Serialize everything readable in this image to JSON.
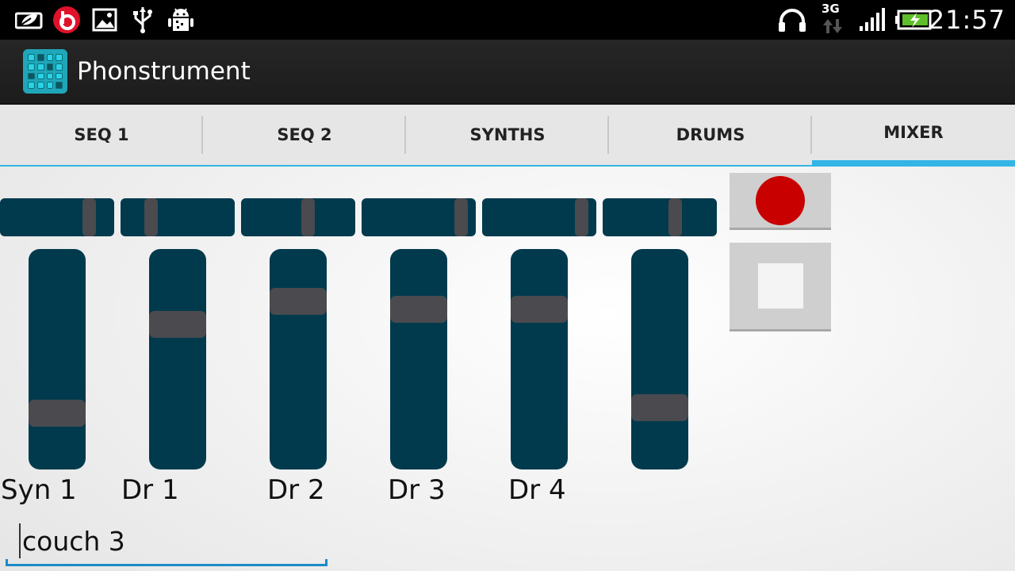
{
  "status_bar": {
    "time": "21:57",
    "network": "3G",
    "left_icons": [
      "eco-mode-icon",
      "beats-audio-icon",
      "image-icon",
      "usb-icon",
      "android-debug-icon"
    ],
    "right_icons": [
      "headphones-icon",
      "data-transfer-icon",
      "signal-icon",
      "battery-charging-icon"
    ]
  },
  "app": {
    "title": "Phonstrument",
    "icon": "grid-sequencer-icon",
    "accent_color": "#33b5e5"
  },
  "tabs": [
    {
      "label": "SEQ 1",
      "selected": false
    },
    {
      "label": "SEQ 2",
      "selected": false
    },
    {
      "label": "SYNTHS",
      "selected": false
    },
    {
      "label": "DRUMS",
      "selected": false
    },
    {
      "label": "MIXER",
      "selected": true
    }
  ],
  "mixer": {
    "channels": [
      {
        "label": "Syn 1",
        "pan": 0.82,
        "volume": 0.22
      },
      {
        "label": "Dr 1",
        "pan": 0.24,
        "volume": 0.68
      },
      {
        "label": "Dr 2",
        "pan": 0.6,
        "volume": 0.8
      },
      {
        "label": "Dr 3",
        "pan": 0.92,
        "volume": 0.76
      },
      {
        "label": "Dr 4",
        "pan": 0.92,
        "volume": 0.76
      },
      {
        "label": "",
        "pan": 0.65,
        "volume": 0.25
      }
    ],
    "colors": {
      "track": "#013a4d",
      "thumb": "#4a4a4f",
      "record": "#c80000"
    }
  },
  "transport": {
    "record_icon": "record-icon",
    "stop_icon": "stop-icon"
  },
  "name_field": {
    "value": "couch 3"
  }
}
